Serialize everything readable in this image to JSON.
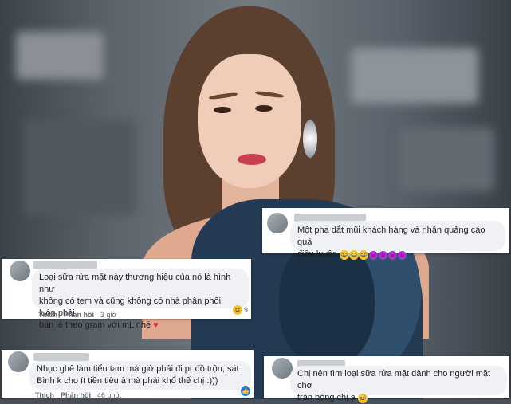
{
  "comments": [
    {
      "text_line1": "Một pha dắt mũi khách hàng và nhận quảng cáo quá",
      "text_line2": "điêu luyện",
      "emoji_icons": [
        "rofl-emoji",
        "rofl-emoji",
        "rofl-emoji",
        "devil-emoji",
        "devil-emoji",
        "devil-emoji",
        "devil-emoji"
      ]
    },
    {
      "text_line1": "Loại sữa rửa mặt này thương hiệu của nó là hình như",
      "text_line2": "không có tem và cũng không có nhà phân phối luôn,phải",
      "text_line3": "bán lẻ theo gram với mL nhé",
      "reaction_count": "9",
      "like_label": "Thích",
      "reply_label": "Phản hồi",
      "time": "3 giờ"
    },
    {
      "text_line1": "Nhục ghê làm tiểu tam mà giờ phải đi pr đồ trộn, sát",
      "text_line2": "Bình k cho ít tiền tiêu à mà phải khổ thế chị :)))",
      "like_label": "Thích",
      "reply_label": "Phản hồi",
      "time": "46 phút"
    },
    {
      "text_line1": "Chị nên tìm loại sữa rửa mặt dành cho người mặt chơ",
      "text_line2": "trán bóng chị ạ"
    }
  ],
  "colors": {
    "bubble": "#eff1f4",
    "text": "#1c1e21",
    "meta": "#65676b",
    "heart": "#e41e3f",
    "like_blue": "#1877f2"
  }
}
